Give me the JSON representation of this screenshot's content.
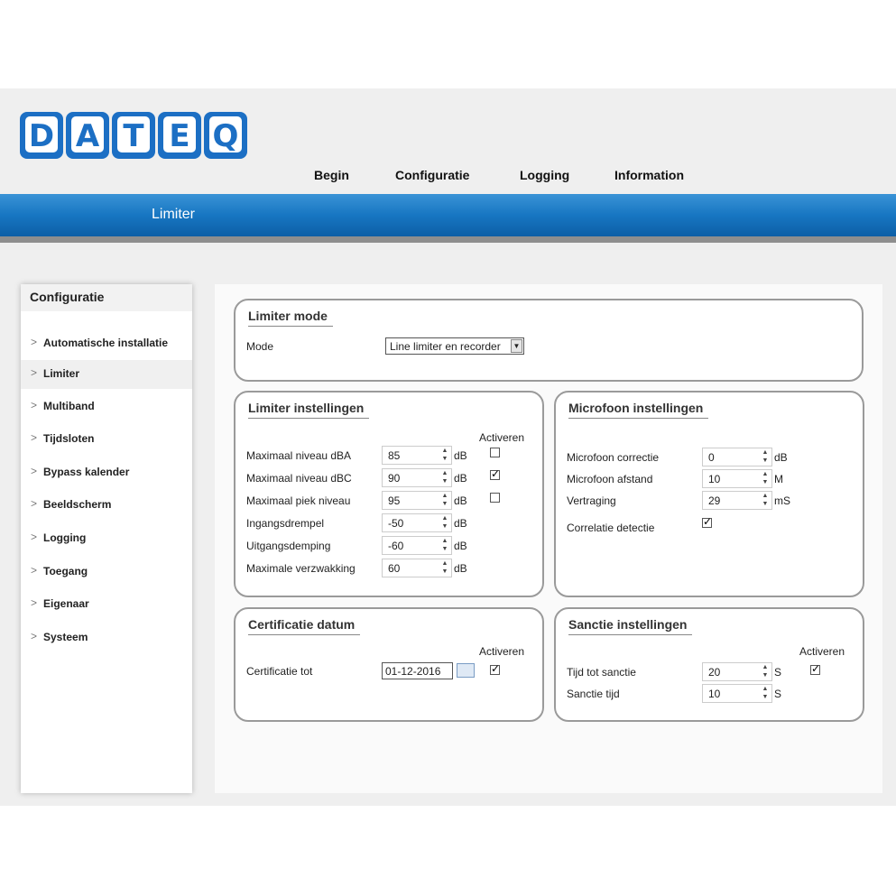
{
  "brand": {
    "logo_text": "DATEQ",
    "color": "#1c6fc4"
  },
  "nav": {
    "items": [
      "Begin",
      "Configuratie",
      "Logging",
      "Information"
    ]
  },
  "page": {
    "title": "Limiter"
  },
  "sidebar": {
    "header": "Configuratie",
    "items": [
      "Automatische installatie",
      "Limiter",
      "Multiband",
      "Tijdsloten",
      "Bypass kalender",
      "Beeldscherm",
      "Logging",
      "Toegang",
      "Eigenaar",
      "Systeem"
    ],
    "active": "Limiter"
  },
  "limiter_mode": {
    "title": "Limiter mode",
    "mode_label": "Mode",
    "mode_value": "Line limiter en recorder"
  },
  "limiter_settings": {
    "title": "Limiter instellingen",
    "activate_header": "Activeren",
    "rows": [
      {
        "label": "Maximaal niveau dBA",
        "value": "85",
        "unit": "dB",
        "checkbox": true,
        "checked": false
      },
      {
        "label": "Maximaal niveau dBC",
        "value": "90",
        "unit": "dB",
        "checkbox": true,
        "checked": true
      },
      {
        "label": "Maximaal piek niveau",
        "value": "95",
        "unit": "dB",
        "checkbox": true,
        "checked": false
      },
      {
        "label": "Ingangsdrempel",
        "value": "-50",
        "unit": "dB",
        "checkbox": false
      },
      {
        "label": "Uitgangsdemping",
        "value": "-60",
        "unit": "dB",
        "checkbox": false
      },
      {
        "label": "Maximale verzwakking",
        "value": "60",
        "unit": "dB",
        "checkbox": false
      }
    ]
  },
  "mic_settings": {
    "title": "Microfoon instellingen",
    "rows": [
      {
        "label": "Microfoon correctie",
        "value": "0",
        "unit": "dB"
      },
      {
        "label": "Microfoon afstand",
        "value": "10",
        "unit": "M"
      },
      {
        "label": "Vertraging",
        "value": "29",
        "unit": "mS"
      }
    ],
    "correlation_label": "Correlatie detectie",
    "correlation_checked": true
  },
  "cert": {
    "title": "Certificatie datum",
    "activate_header": "Activeren",
    "label": "Certificatie tot",
    "value": "01-12-2016",
    "checked": true
  },
  "sanction": {
    "title": "Sanctie instellingen",
    "activate_header": "Activeren",
    "rows": [
      {
        "label": "Tijd tot sanctie",
        "value": "20",
        "unit": "S",
        "checkbox": true,
        "checked": true
      },
      {
        "label": "Sanctie tijd",
        "value": "10",
        "unit": "S",
        "checkbox": false
      }
    ]
  }
}
